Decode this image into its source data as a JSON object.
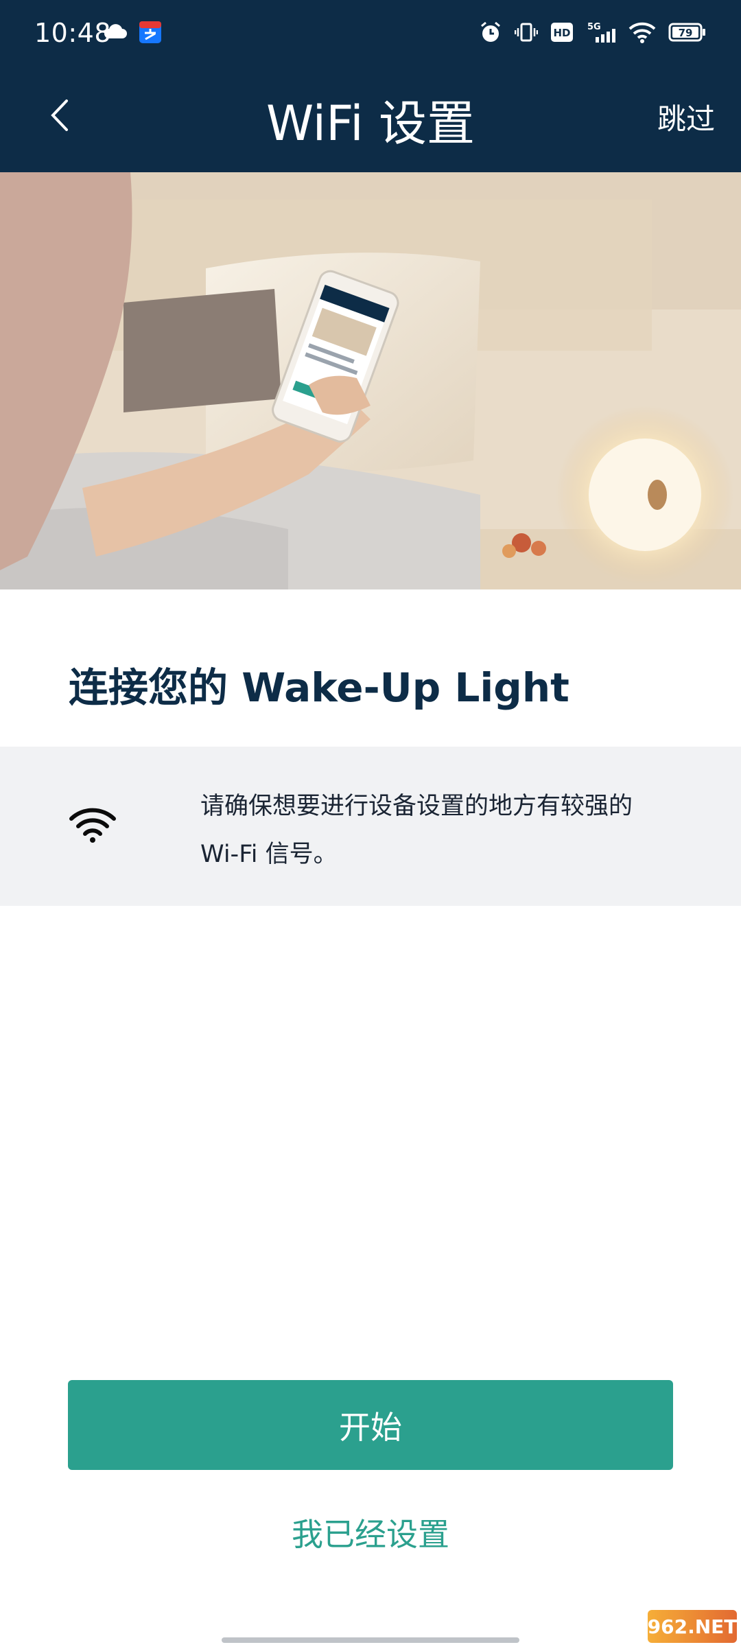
{
  "status_bar": {
    "time": "10:48",
    "battery": "79",
    "network": "5G",
    "hd_badge": "HD"
  },
  "header": {
    "title": "WiFi 设置",
    "skip_label": "跳过"
  },
  "content": {
    "headline": "连接您的 Wake-Up Light",
    "tip_line1": "请确保想要进行设备设置的地方有较强的",
    "tip_line2": "Wi-Fi 信号。"
  },
  "actions": {
    "start_label": "开始",
    "already_set_label": "我已经设置"
  },
  "watermark": {
    "text": "962.NET"
  },
  "colors": {
    "header_bg": "#0d2c47",
    "accent": "#2ba08e",
    "panel_bg": "#f1f2f4"
  }
}
